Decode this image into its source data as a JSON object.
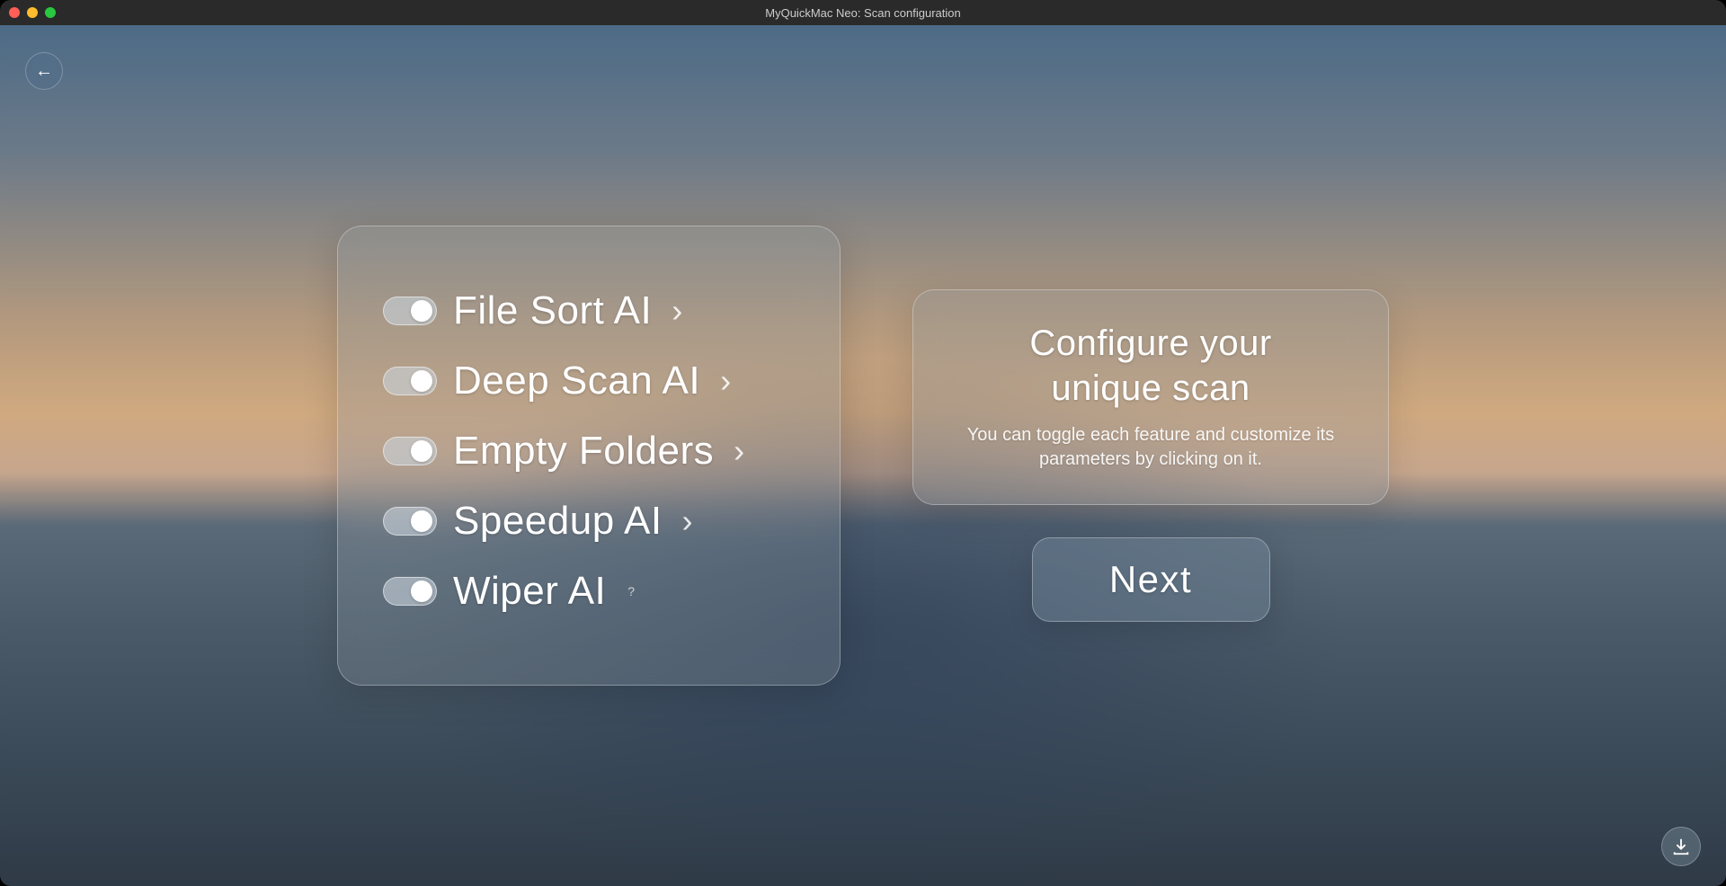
{
  "window": {
    "title": "MyQuickMac Neo: Scan configuration"
  },
  "features": [
    {
      "label": "File Sort AI",
      "has_chevron": true,
      "has_help": false
    },
    {
      "label": "Deep Scan AI",
      "has_chevron": true,
      "has_help": false
    },
    {
      "label": "Empty Folders",
      "has_chevron": true,
      "has_help": false
    },
    {
      "label": "Speedup AI",
      "has_chevron": true,
      "has_help": false
    },
    {
      "label": "Wiper AI",
      "has_chevron": false,
      "has_help": true
    }
  ],
  "info": {
    "title_line1": "Configure your",
    "title_line2": "unique scan",
    "description": "You can toggle each feature and customize its parameters by clicking on it."
  },
  "buttons": {
    "next": "Next"
  },
  "icons": {
    "back": "←",
    "chevron": "›",
    "help": "?"
  }
}
